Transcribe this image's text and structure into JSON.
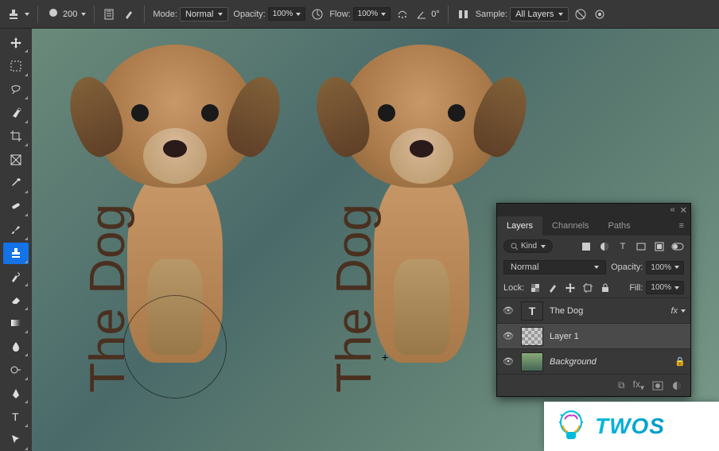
{
  "options_bar": {
    "brush_size": "200",
    "mode_label": "Normal",
    "opacity_label": "Opacity:",
    "opacity_value": "100%",
    "flow_label": "Flow:",
    "flow_value": "100%",
    "angle_label": "0°",
    "sample_label": "All Layers"
  },
  "canvas_text": {
    "left": "The Dog",
    "right": "The Dog"
  },
  "layers_panel": {
    "tabs": [
      "Layers",
      "Channels",
      "Paths"
    ],
    "filter_label": "Kind",
    "blend_mode": "Normal",
    "opacity_label": "Opacity:",
    "opacity_value": "100%",
    "lock_label": "Lock:",
    "fill_label": "Fill:",
    "fill_value": "100%",
    "layers": [
      {
        "name": "The Dog",
        "type": "text",
        "fx": true
      },
      {
        "name": "Layer 1",
        "type": "raster"
      },
      {
        "name": "Background",
        "type": "bg",
        "locked": true
      }
    ]
  },
  "watermark": {
    "text": "TWOS"
  }
}
